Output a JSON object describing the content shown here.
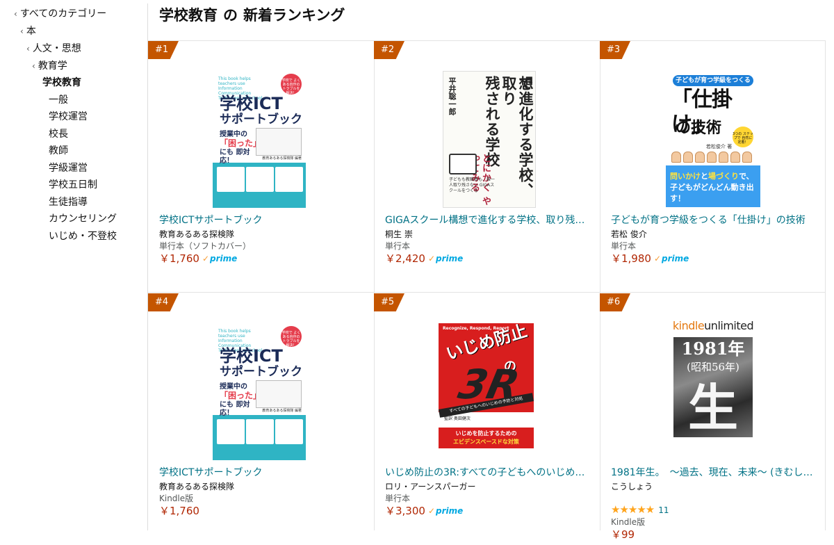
{
  "sidebar": {
    "breadcrumbs": [
      {
        "label": "すべてのカテゴリー"
      },
      {
        "label": "本"
      },
      {
        "label": "人文・思想"
      },
      {
        "label": "教育学"
      }
    ],
    "current": "学校教育",
    "children": [
      "一般",
      "学校運営",
      "校長",
      "教師",
      "学級運営",
      "学校五日制",
      "生徒指導",
      "カウンセリング",
      "いじめ・不登校"
    ]
  },
  "header": {
    "category": "学校教育",
    "connector": "の",
    "suffix": "新着ランキング"
  },
  "items": [
    {
      "rank": "#1",
      "title": "学校ICTサポートブック",
      "author": "教育あるある探検隊",
      "format": "単行本（ソフトカバー）",
      "price": "￥1,760",
      "prime": "prime",
      "cover": {
        "en": "This book helps teachers use Information Communication Technology at School.",
        "seal": "学校で よくある自作の トラブルを 解決！",
        "title1": "学校ICT",
        "title2": "サポートブック",
        "sub1": "授業中の",
        "sub2": "「困った」",
        "sub3": "にも 即対応！",
        "publisher": "教育あるある探検隊 編著"
      }
    },
    {
      "rank": "#2",
      "title": "GIGAスクール構想で進化する学校、取り残さ…",
      "author": "桐生 崇",
      "format": "単行本",
      "price": "￥2,420",
      "prime": "prime",
      "cover": {
        "title1": "GIGAスクール構想",
        "title2": "で進化する学校、取り",
        "title3": "残される学校",
        "author": "平井聡一郎",
        "catch": "とにかく やってみる",
        "note": "子どもも教職員も、誰一人取り残さない GIGAスクールをつくる"
      }
    },
    {
      "rank": "#3",
      "title": "子どもが育つ学級をつくる「仕掛け」の技術",
      "author": "若松 俊介",
      "format": "単行本",
      "price": "￥1,980",
      "prime": "prime",
      "cover": {
        "band": "子どもが育つ学級をつくる",
        "big": "「仕掛け」",
        "gi": "の技術",
        "badge": "3つの ステップで 自然に定着！",
        "author": "若松俊介 著",
        "blue1": "問いかけ",
        "blue2": "と",
        "blue3": "場づくり",
        "blue4": "で、",
        "blue5": "子どもがどんどん動き出す！"
      }
    },
    {
      "rank": "#4",
      "title": "学校ICTサポートブック",
      "author": "教育あるある探検隊",
      "format": "Kindle版",
      "price": "￥1,760",
      "cover": {
        "en": "This book helps teachers use Information Communication Technology at School.",
        "seal": "学校で よくある自作の トラブルを 解決！",
        "title1": "学校ICT",
        "title2": "サポートブック",
        "sub1": "授業中の",
        "sub2": "「困った」",
        "sub3": "にも 即対応！",
        "publisher": "教育あるある探検隊 編著"
      }
    },
    {
      "rank": "#5",
      "title": "いじめ防止の3R:すべての子どもへのいじめの…",
      "author": "ロリ・アーンスパーガー",
      "format": "単行本",
      "price": "￥3,300",
      "prime": "prime",
      "cover": {
        "en": "Recognize, Respond, Report",
        "ijime": "いじめ防止",
        "no": "の",
        "r3": "3R",
        "stripe": "すべての子どもへのいじめの予防と対処",
        "names": "監訳 奥田健次",
        "box1": "いじめを防止するための",
        "box2": "エビデンスベースドな対策"
      }
    },
    {
      "rank": "#6",
      "title": "1981年生。　～過去、現在、未来～ (きむし…",
      "author": "こうしょう",
      "format": "Kindle版",
      "price": "￥99",
      "rating": 5,
      "rating_count": "11",
      "cover": {
        "ku1": "kindle",
        "ku2": "unlimited",
        "year": "1981年",
        "era": "(昭和56年)",
        "sei": "生"
      }
    }
  ],
  "colors": {
    "rank_badge": "#c45500",
    "link": "#007185",
    "price": "#b12704",
    "prime": "#00a8e1",
    "star": "#ffa41c"
  }
}
